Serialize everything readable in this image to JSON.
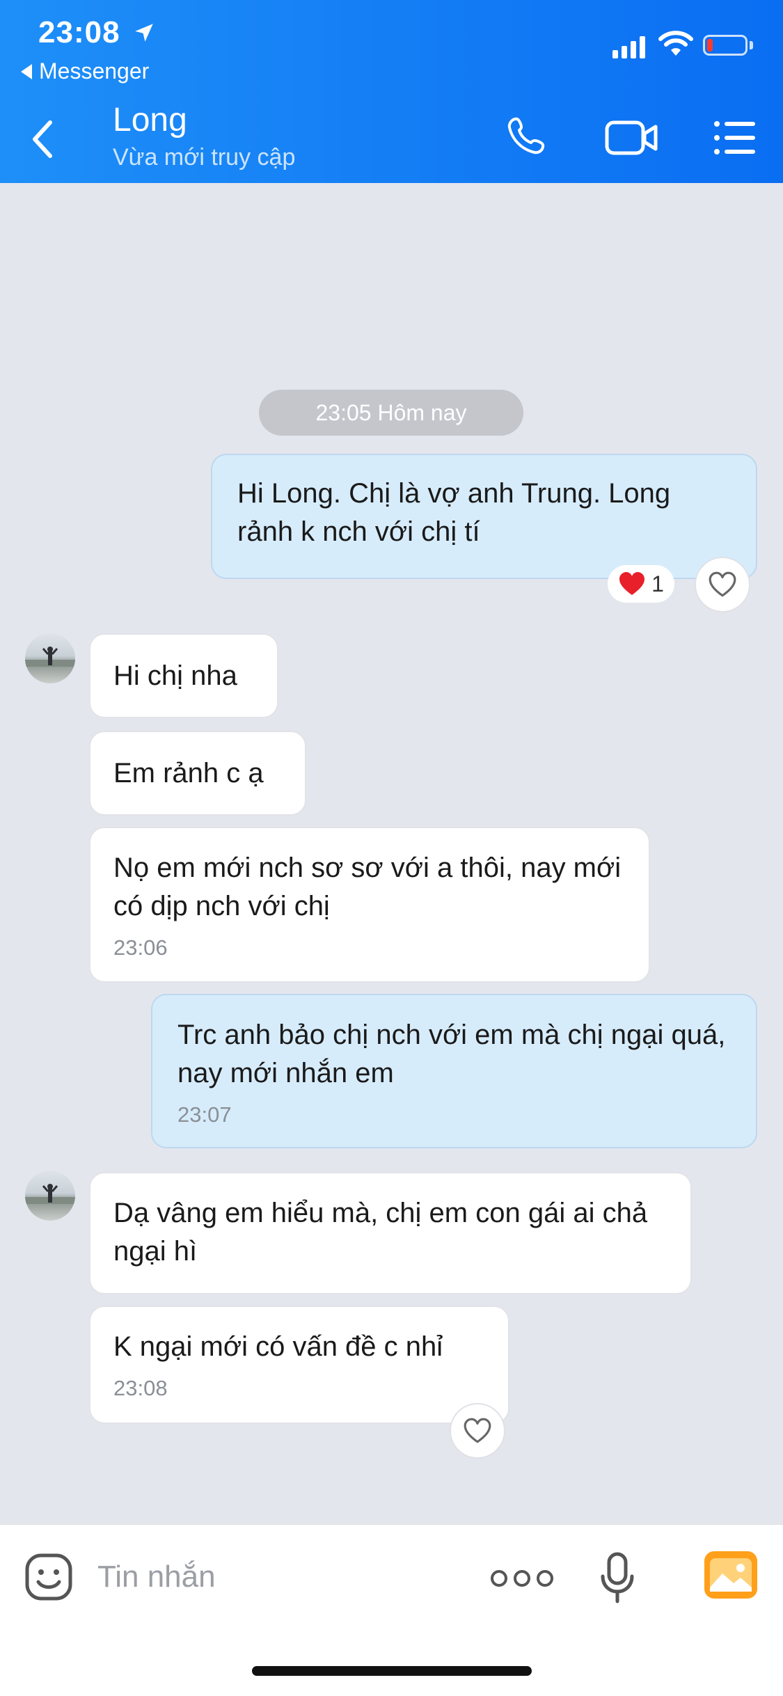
{
  "status_bar": {
    "time": "23:08",
    "back_app_label": "Messenger"
  },
  "header": {
    "contact_name": "Long",
    "contact_status": "Vừa mới truy cập"
  },
  "conversation": {
    "date_divider": "23:05 Hôm nay",
    "messages": [
      {
        "sender": "me",
        "text": "Hi Long. Chị là vợ anh Trung. Long rảnh k nch với chị tí",
        "reaction": {
          "emoji": "heart",
          "count": "1"
        }
      },
      {
        "sender": "Long",
        "text": "Hi chị nha"
      },
      {
        "sender": "Long",
        "text": "Em rảnh c ạ"
      },
      {
        "sender": "Long",
        "text": "Nọ em mới nch sơ sơ với a thôi, nay mới có dịp nch với chị",
        "time": "23:06"
      },
      {
        "sender": "me",
        "text": "Trc anh bảo chị nch với em mà chị ngại quá, nay mới nhắn em",
        "time": "23:07"
      },
      {
        "sender": "Long",
        "text": "Dạ vâng em hiểu mà, chị em con gái ai chả ngại hì"
      },
      {
        "sender": "Long",
        "text": "K ngại mới có vấn đề c nhỉ",
        "time": "23:08"
      }
    ]
  },
  "input_bar": {
    "placeholder": "Tin nhắn"
  },
  "colors": {
    "header_blue": "#0a6ef2",
    "outgoing_bubble": "#d7ecfb",
    "incoming_bubble": "#ffffff",
    "background": "#e4e6ee",
    "reaction_heart": "#e8202a",
    "photo_button": "#ff9f1a"
  },
  "icons": [
    "location-arrow-icon",
    "back-chevron-icon",
    "cellular-signal-icon",
    "wifi-icon",
    "battery-icon",
    "phone-call-icon",
    "video-call-icon",
    "menu-icon",
    "heart-icon",
    "emoji-sticker-icon",
    "more-dots-icon",
    "microphone-icon",
    "photo-icon"
  ]
}
